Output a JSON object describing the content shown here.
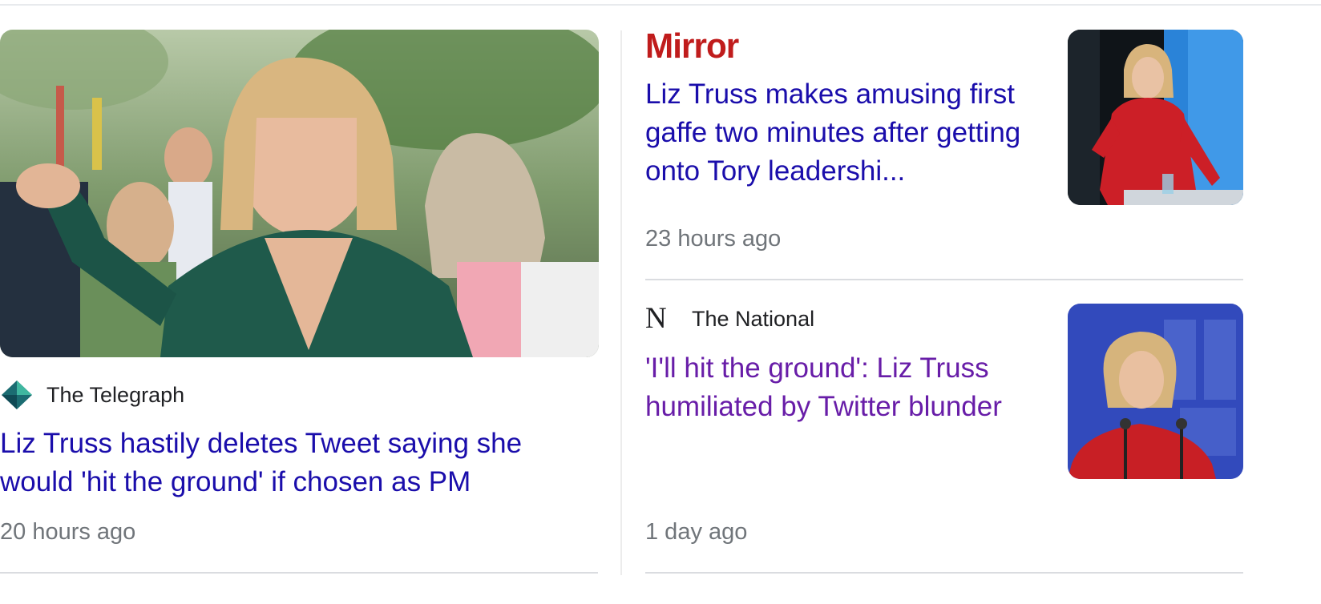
{
  "cards": {
    "telegraph": {
      "source": "The Telegraph",
      "headline": "Liz Truss hastily deletes Tweet saying she would 'hit the ground' if chosen as PM",
      "time": "20 hours ago"
    },
    "mirror": {
      "source": "Mirror",
      "headline": "Liz Truss makes amusing first gaffe two minutes after getting onto Tory leadershi...",
      "time": "23 hours ago"
    },
    "national": {
      "source": "The National",
      "source_icon": "N",
      "headline": "'I'll hit the ground': Liz Truss humiliated by Twitter blunder",
      "time": "1 day ago"
    }
  },
  "colors": {
    "link": "#1a0dab",
    "visited_link": "#681da8",
    "meta": "#70757a",
    "mirror_brand": "#c01c1c",
    "divider": "#dadce0"
  },
  "icons": [
    "telegraph-logo-icon",
    "national-logo-icon"
  ]
}
